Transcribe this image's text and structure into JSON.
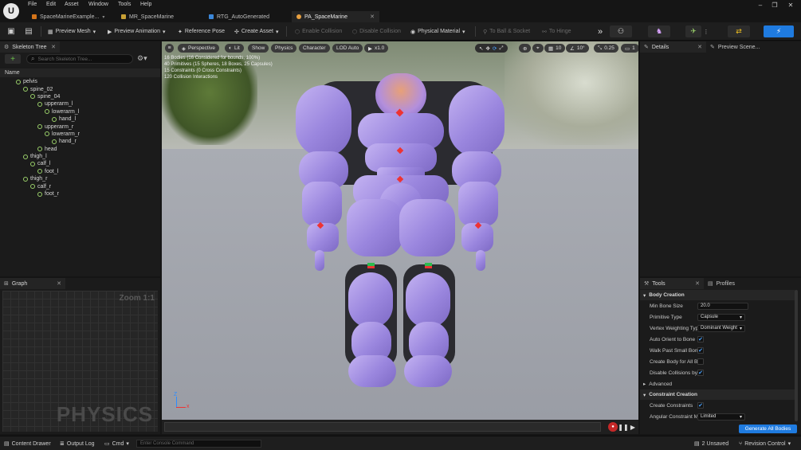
{
  "menubar": {
    "items": [
      "File",
      "Edit",
      "Asset",
      "Window",
      "Tools",
      "Help"
    ],
    "tabs": [
      {
        "label": "SpaceMarineExample...",
        "color": "#d4741a"
      },
      {
        "label": "MR_SpaceMarine",
        "color": "#c8a035"
      },
      {
        "label": "RTG_AutoGenerated",
        "color": "#3b87d9"
      },
      {
        "label": "PA_SpaceMarine",
        "color": "#e8a040"
      }
    ]
  },
  "toolbar": {
    "preview_mesh": "Preview Mesh",
    "preview_animation": "Preview Animation",
    "reference_pose": "Reference Pose",
    "create_asset": "Create Asset",
    "enable_collision": "Enable Collision",
    "disable_collision": "Disable Collision",
    "physical_material": "Physical Material",
    "to_ball_socket": "To Ball & Socket",
    "to_hinge": "To Hinge"
  },
  "skeleton": {
    "tab": "Skeleton Tree",
    "search_placeholder": "Search Skeleton Tree...",
    "column": "Name",
    "bones": [
      {
        "name": "pelvis",
        "depth": 0
      },
      {
        "name": "spine_02",
        "depth": 1
      },
      {
        "name": "spine_04",
        "depth": 2
      },
      {
        "name": "upperarm_l",
        "depth": 3
      },
      {
        "name": "lowerarm_l",
        "depth": 4
      },
      {
        "name": "hand_l",
        "depth": 5
      },
      {
        "name": "upperarm_r",
        "depth": 3
      },
      {
        "name": "lowerarm_r",
        "depth": 4
      },
      {
        "name": "hand_r",
        "depth": 5
      },
      {
        "name": "head",
        "depth": 3
      },
      {
        "name": "thigh_l",
        "depth": 1
      },
      {
        "name": "calf_l",
        "depth": 2
      },
      {
        "name": "foot_l",
        "depth": 3
      },
      {
        "name": "thigh_r",
        "depth": 1
      },
      {
        "name": "calf_r",
        "depth": 2
      },
      {
        "name": "foot_r",
        "depth": 3
      }
    ]
  },
  "graph": {
    "tab": "Graph",
    "zoom": "Zoom 1:1",
    "watermark": "PHYSICS"
  },
  "viewport": {
    "perspective": "Perspective",
    "lit": "Lit",
    "show": "Show",
    "physics": "Physics",
    "character": "Character",
    "lod": "LOD Auto",
    "speed": "x1.0",
    "grid": "10",
    "angle": "10°",
    "scale": "0.25",
    "camera": "1",
    "stats": [
      "16 Bodies (16 Considered for bounds, 100%)",
      "40 Primitives (15 Spheres, 18 Boxes, 25 Capsules)",
      "15 Constraints (0 Cross Constraints)",
      "120 Collision Interactions"
    ]
  },
  "details": {
    "tab": "Details",
    "preview_tab": "Preview Scene..."
  },
  "tools": {
    "tab": "Tools",
    "profiles_tab": "Profiles",
    "body_creation": "Body Creation",
    "min_bone_size_label": "Min Bone Size",
    "min_bone_size": "20.0",
    "primitive_type_label": "Primitive Type",
    "primitive_type": "Capsule",
    "vertex_weighting_label": "Vertex Weighting Type",
    "vertex_weighting": "Dominant Weight",
    "auto_orient_label": "Auto Orient to Bone",
    "walk_past_label": "Walk Past Small Bones",
    "create_body_label": "Create Body for All Bo...",
    "disable_collisions_label": "Disable Collisions by D...",
    "advanced": "Advanced",
    "constraint_creation": "Constraint Creation",
    "create_constraints_label": "Create Constraints",
    "angular_label": "Angular Constraint Mo...",
    "angular_value": "Limited",
    "generate": "Generate All Bodies"
  },
  "statusbar": {
    "content_drawer": "Content Drawer",
    "output_log": "Output Log",
    "cmd": "Cmd",
    "console_placeholder": "Enter Console Command",
    "unsaved": "2 Unsaved",
    "revision": "Revision Control"
  }
}
